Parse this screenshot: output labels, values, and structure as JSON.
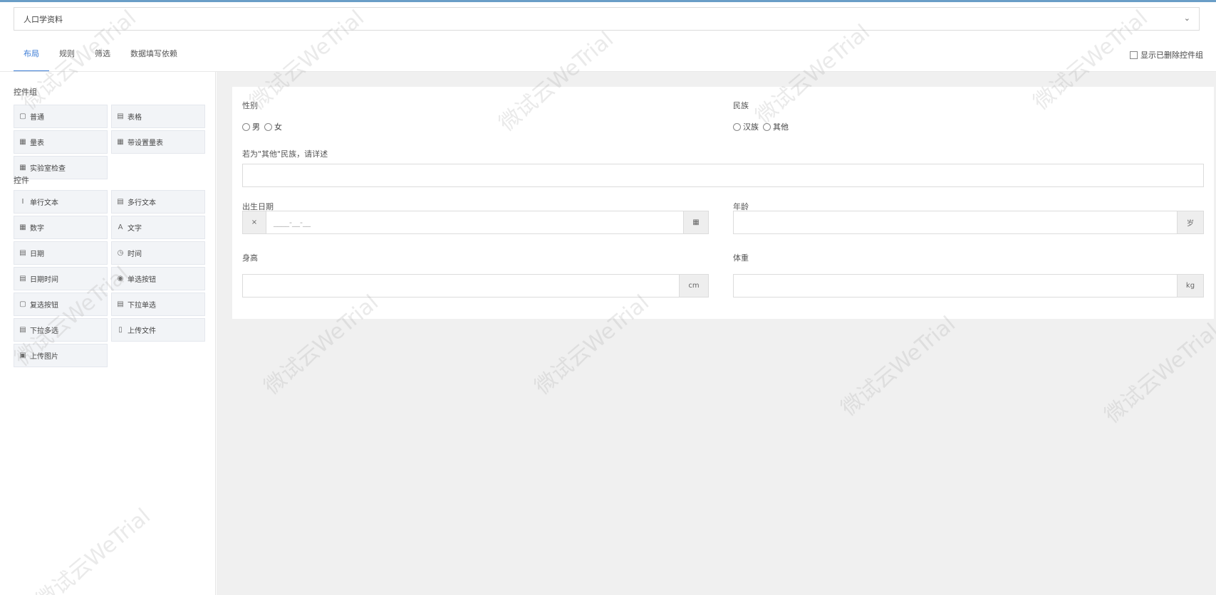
{
  "form_selector": {
    "value": "人口学资料",
    "caret": "⌄"
  },
  "tabs": [
    {
      "label": "布局"
    },
    {
      "label": "规则"
    },
    {
      "label": "筛选"
    },
    {
      "label": "数据填写依赖"
    }
  ],
  "show_deleted_label": "显示已删除控件组",
  "left_panel": {
    "group_section_title": "控件组",
    "group_items": [
      {
        "icon": "▢",
        "label": "普通"
      },
      {
        "icon": "▤",
        "label": "表格"
      },
      {
        "icon": "▦",
        "label": "量表"
      },
      {
        "icon": "▦",
        "label": "带设置量表"
      },
      {
        "icon": "▦",
        "label": "实验室检查"
      }
    ],
    "control_section_title": "控件",
    "control_items": [
      {
        "icon": "I",
        "label": "单行文本"
      },
      {
        "icon": "▤",
        "label": "多行文本"
      },
      {
        "icon": "▦",
        "label": "数字"
      },
      {
        "icon": "A",
        "label": "文字"
      },
      {
        "icon": "▤",
        "label": "日期"
      },
      {
        "icon": "◷",
        "label": "时间"
      },
      {
        "icon": "▤",
        "label": "日期时间"
      },
      {
        "icon": "◉",
        "label": "单选按钮"
      },
      {
        "icon": "▢",
        "label": "复选按钮"
      },
      {
        "icon": "▤",
        "label": "下拉单选"
      },
      {
        "icon": "▤",
        "label": "下拉多选"
      },
      {
        "icon": "▯",
        "label": "上传文件"
      },
      {
        "icon": "▣",
        "label": "上传图片"
      }
    ]
  },
  "form": {
    "gender": {
      "label": "性别",
      "options": [
        "男",
        "女"
      ]
    },
    "ethnicity": {
      "label": "民族",
      "options": [
        "汉族",
        "其他"
      ]
    },
    "other_ethnicity": {
      "label": "若为\"其他\"民族，请详述",
      "value": ""
    },
    "birth_date": {
      "label": "出生日期",
      "prefix": "×",
      "placeholder": "____-__-__",
      "suffix_icon": "▦"
    },
    "age": {
      "label": "年龄",
      "unit": "岁"
    },
    "height": {
      "label": "身高",
      "unit": "cm"
    },
    "weight": {
      "label": "体重",
      "unit": "kg"
    }
  },
  "watermark_text": "微试云WeTrial"
}
